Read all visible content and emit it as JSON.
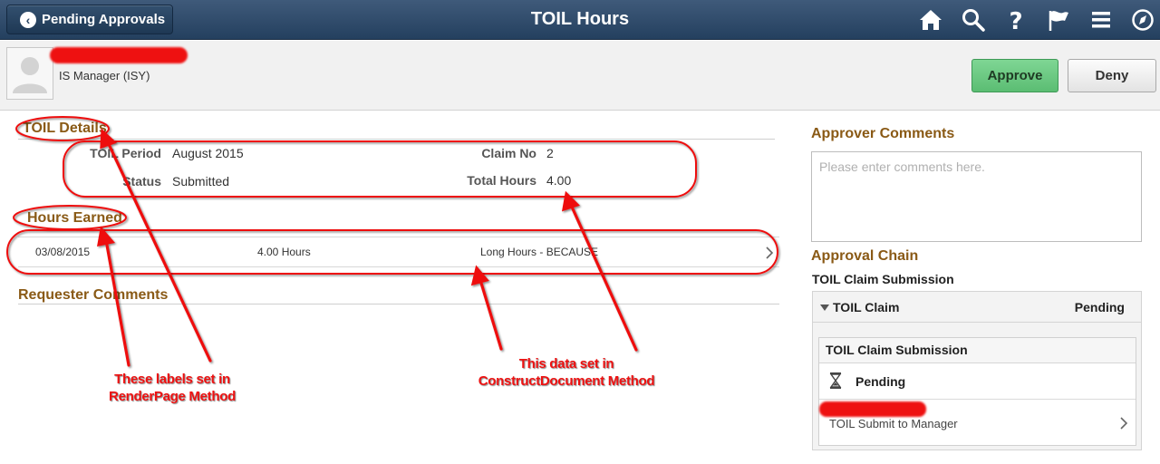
{
  "header": {
    "back_label": "Pending Approvals",
    "title": "TOIL Hours",
    "icons": [
      "home-icon",
      "search-icon",
      "help-icon",
      "flag-icon",
      "menu-icon",
      "navbar-icon"
    ]
  },
  "approver": {
    "role": "IS Manager (ISY)",
    "approve_label": "Approve",
    "deny_label": "Deny"
  },
  "toil_details": {
    "heading": "TOIL Details",
    "period_label": "TOIL Period",
    "period_value": "August 2015",
    "status_label": "Status",
    "status_value": "Submitted",
    "claim_label": "Claim No",
    "claim_value": "2",
    "total_label": "Total Hours",
    "total_value": "4.00"
  },
  "hours_earned": {
    "heading": "Hours Earned",
    "rows": [
      {
        "date": "03/08/2015",
        "hours": "4.00 Hours",
        "reason": "Long Hours - BECAUSE"
      }
    ]
  },
  "requester_comments": {
    "heading": "Requester Comments"
  },
  "approver_comments": {
    "heading": "Approver Comments",
    "placeholder": "Please enter comments here."
  },
  "approval_chain": {
    "heading": "Approval Chain",
    "subheading": "TOIL Claim Submission",
    "group_title": "TOIL Claim",
    "group_status": "Pending",
    "step_title": "TOIL Claim Submission",
    "step_status": "Pending",
    "step_approver": "TOIL Submit to Manager"
  },
  "annotations": {
    "labels_note": [
      "These labels set in",
      "RenderPage Method"
    ],
    "data_note": [
      "This data set in",
      "ConstructDocument Method"
    ]
  },
  "colors": {
    "header_bg": "#2c4766",
    "section_heading": "#8a5a16",
    "approve_bg": "#6cc985",
    "annotation": "#ee1111"
  }
}
